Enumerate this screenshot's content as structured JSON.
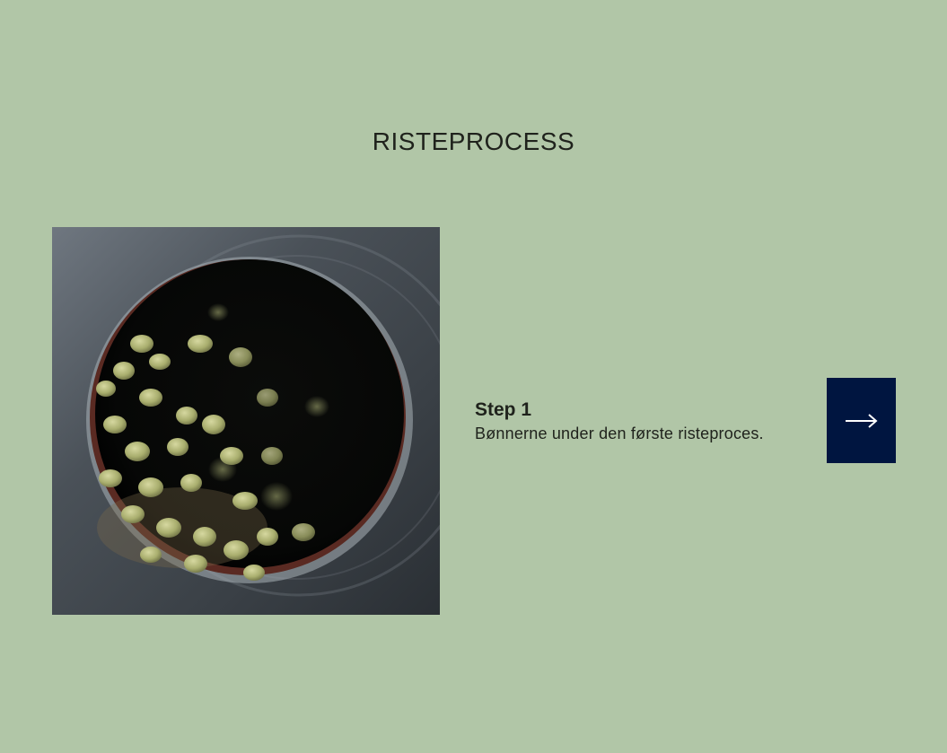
{
  "section": {
    "title": "RISTEPROCESS"
  },
  "step": {
    "heading": "Step 1",
    "description": "Bønnerne under den første risteproces.",
    "image_subject": "green coffee beans tumbling inside roaster drum window"
  },
  "navigation": {
    "next_icon": "arrow-right-icon"
  },
  "colors": {
    "background": "#b1c6a7",
    "text": "#1f221c",
    "button": "#001540",
    "button_icon": "#ffffff"
  }
}
